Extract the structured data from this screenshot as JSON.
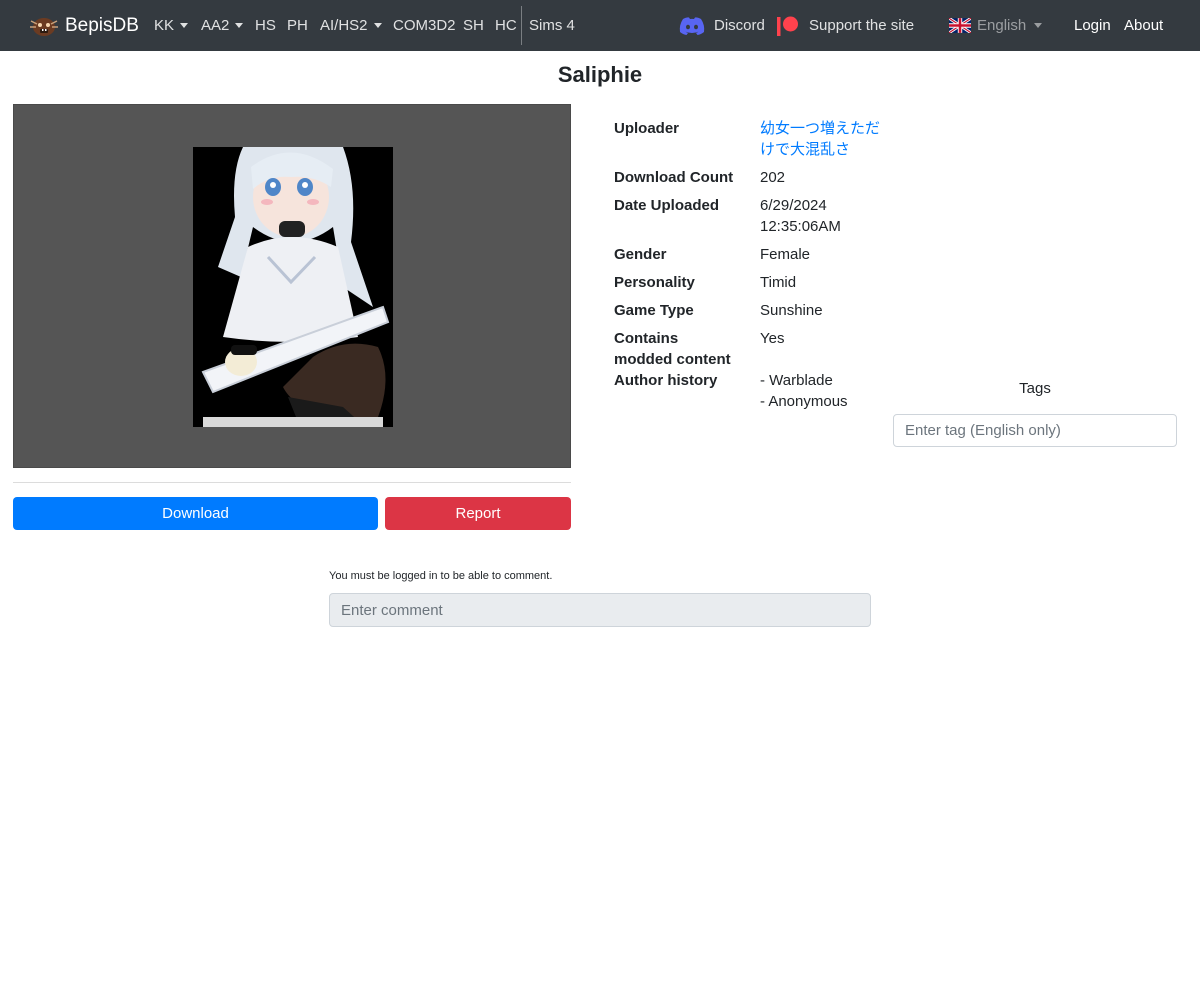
{
  "nav": {
    "brand": "BepisDB",
    "items": [
      {
        "label": "KK",
        "dropdown": true
      },
      {
        "label": "AA2",
        "dropdown": true
      },
      {
        "label": "HS",
        "dropdown": false
      },
      {
        "label": "PH",
        "dropdown": false
      },
      {
        "label": "AI/HS2",
        "dropdown": true
      },
      {
        "label": "COM3D2",
        "dropdown": false
      },
      {
        "label": "SH",
        "dropdown": false
      },
      {
        "label": "HC",
        "dropdown": false
      },
      {
        "label": "Sims 4",
        "dropdown": false
      }
    ],
    "discord": "Discord",
    "support": "Support the site",
    "language": "English",
    "login": "Login",
    "about": "About",
    "colors": {
      "navbar": "#343a40",
      "discord": "#5865F2",
      "patreon": "#FF424D"
    }
  },
  "card": {
    "title": "Saliphie",
    "download_label": "Download",
    "report_label": "Report",
    "details": {
      "uploader_label": "Uploader",
      "uploader_value": "幼女一つ増えただけで大混乱さ",
      "download_count_label": "Download Count",
      "download_count_value": "202",
      "date_label": "Date Uploaded",
      "date_line1": "6/29/2024",
      "date_line2": "12:35:06AM",
      "gender_label": "Gender",
      "gender_value": "Female",
      "personality_label": "Personality",
      "personality_value": "Timid",
      "game_type_label": "Game Type",
      "game_type_value": "Sunshine",
      "modded_label_line1": "Contains",
      "modded_label_line2": "modded content",
      "modded_value": "Yes",
      "author_history_label": "Author history",
      "author_history": [
        "- Warblade",
        "- Anonymous"
      ]
    },
    "colors": {
      "download": "#007bff",
      "report": "#dc3545",
      "link": "#007bff"
    }
  },
  "tags": {
    "label": "Tags",
    "placeholder": "Enter tag (English only)"
  },
  "comments": {
    "note": "You must be logged in to be able to comment.",
    "placeholder": "Enter comment"
  }
}
